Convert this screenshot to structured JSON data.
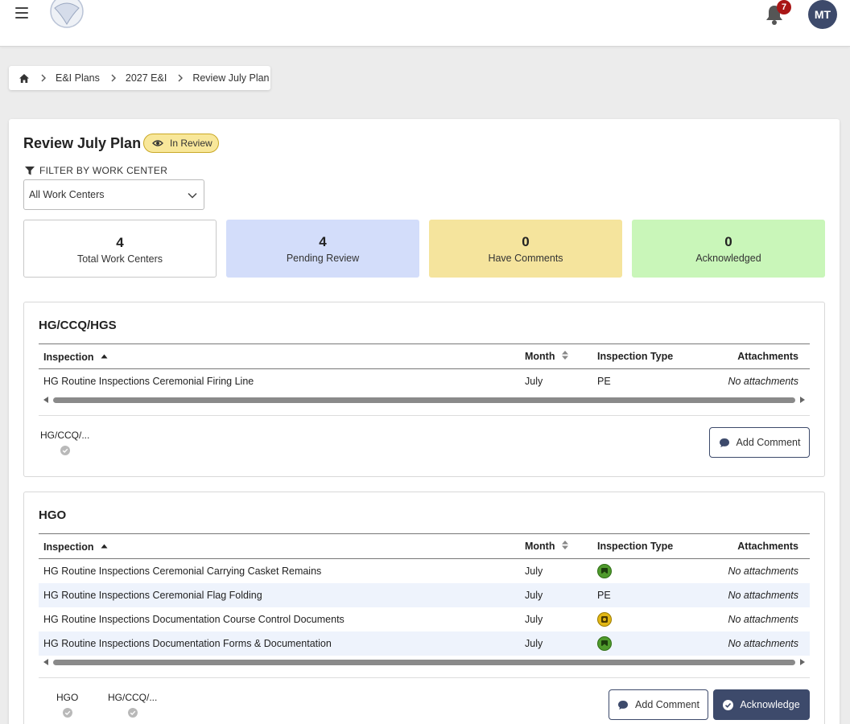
{
  "header": {
    "notification_count": "7",
    "avatar_initials": "MT"
  },
  "breadcrumb": [
    {
      "label": "E&I Plans"
    },
    {
      "label": "2027 E&I"
    },
    {
      "label": "Review July Plan"
    }
  ],
  "page": {
    "title": "Review July Plan",
    "status": "In Review"
  },
  "filter": {
    "label": "FILTER BY WORK CENTER",
    "value": "All Work Centers"
  },
  "stats": [
    {
      "value": "4",
      "label": "Total Work Centers"
    },
    {
      "value": "4",
      "label": "Pending Review"
    },
    {
      "value": "0",
      "label": "Have Comments"
    },
    {
      "value": "0",
      "label": "Acknowledged"
    }
  ],
  "columns": {
    "inspection": "Inspection",
    "month": "Month",
    "type": "Inspection Type",
    "attachments": "Attachments"
  },
  "work_centers": [
    {
      "name": "HG/CCQ/HGS",
      "rows": [
        {
          "inspection": "HG Routine Inspections Ceremonial Firing Line",
          "month": "July",
          "type": "PE",
          "attachments": "No attachments"
        }
      ],
      "tags": [
        "HG/CCQ/..."
      ],
      "buttons": {
        "comment": "Add Comment"
      }
    },
    {
      "name": "HGO",
      "rows": [
        {
          "inspection": "HG Routine Inspections Ceremonial Carrying Casket Remains",
          "month": "July",
          "type": "",
          "type_icon": "green-badge-icon",
          "attachments": "No attachments"
        },
        {
          "inspection": "HG Routine Inspections Ceremonial Flag Folding",
          "month": "July",
          "type": "PE",
          "attachments": "No attachments"
        },
        {
          "inspection": "HG Routine Inspections Documentation Course Control Documents",
          "month": "July",
          "type": "",
          "type_icon": "yellow-badge-icon",
          "attachments": "No attachments"
        },
        {
          "inspection": "HG Routine Inspections Documentation Forms & Documentation",
          "month": "July",
          "type": "",
          "type_icon": "green-badge-icon",
          "attachments": "No attachments"
        }
      ],
      "tags": [
        "HGO",
        "HG/CCQ/..."
      ],
      "buttons": {
        "comment": "Add Comment",
        "acknowledge": "Acknowledge"
      }
    }
  ],
  "colors": {
    "primary": "#3d4a6b",
    "badge_in_review": "#f8e79a",
    "pending": "#d3ddfa",
    "comments": "#f5e49d",
    "acknowledged": "#c9f6b9",
    "notification": "#a91616"
  }
}
